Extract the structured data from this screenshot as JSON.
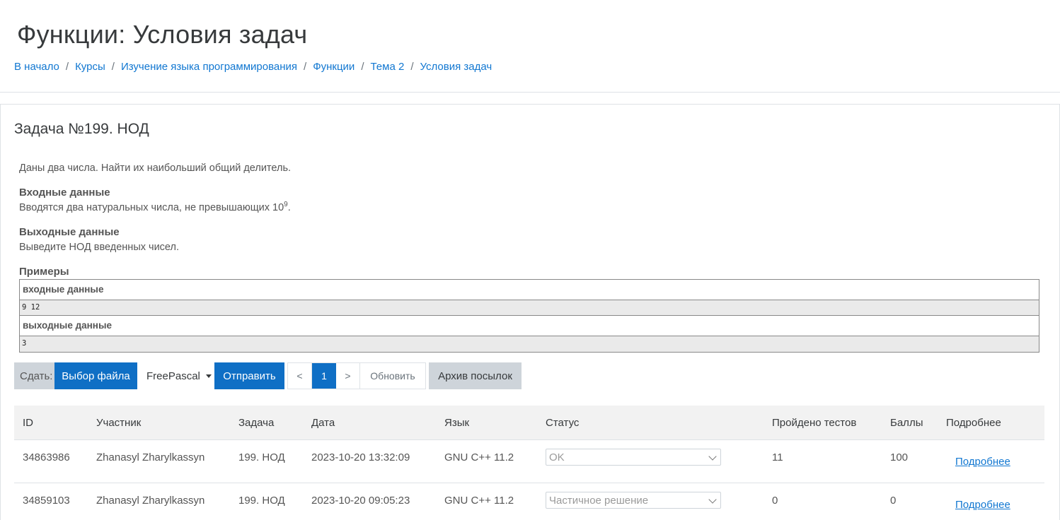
{
  "header": {
    "title": "Функции: Условия задач",
    "breadcrumb": [
      "В начало",
      "Курсы",
      "Изучение языка программирования",
      "Функции",
      "Тема 2",
      "Условия задач"
    ],
    "separator": "/"
  },
  "task": {
    "title": "Задача №199. НОД",
    "statement": "Даны два числа. Найти их наибольший общий делитель.",
    "input_heading": "Входные данные",
    "input_text": "Вводятся два натуральных числа, не превышающих 10",
    "input_exponent": "9",
    "input_text_end": ".",
    "output_heading": "Выходные данные",
    "output_text": "Выведите НОД введенных чисел.",
    "examples_heading": "Примеры",
    "example_input_label": "входные данные",
    "example_input": "9 12",
    "example_output_label": "выходные данные",
    "example_output": "3"
  },
  "toolbar": {
    "submit_label": "Сдать:",
    "choose_file": "Выбор файла",
    "language": "FreePascal",
    "send": "Отправить",
    "prev": "<",
    "page": "1",
    "next": ">",
    "refresh": "Обновить",
    "archive": "Архив посылок"
  },
  "table": {
    "headers": [
      "ID",
      "Участник",
      "Задача",
      "Дата",
      "Язык",
      "Статус",
      "Пройдено тестов",
      "Баллы",
      "Подробнее"
    ],
    "rows": [
      {
        "id": "34863986",
        "user": "Zhanasyl Zharylkassyn",
        "task": "199. НОД",
        "date": "2023-10-20 13:32:09",
        "lang": "GNU C++ 11.2",
        "status": "OK",
        "tests": "11",
        "score": "100",
        "details": "Подробнее"
      },
      {
        "id": "34859103",
        "user": "Zhanasyl Zharylkassyn",
        "task": "199. НОД",
        "date": "2023-10-20 09:05:23",
        "lang": "GNU C++ 11.2",
        "status": "Частичное решение",
        "tests": "0",
        "score": "0",
        "details": "Подробнее"
      }
    ]
  },
  "colors": {
    "primary": "#0f6fc5",
    "link": "#1177d1",
    "gray_button": "#ced4da",
    "table_header_bg": "#f2f2f2"
  }
}
